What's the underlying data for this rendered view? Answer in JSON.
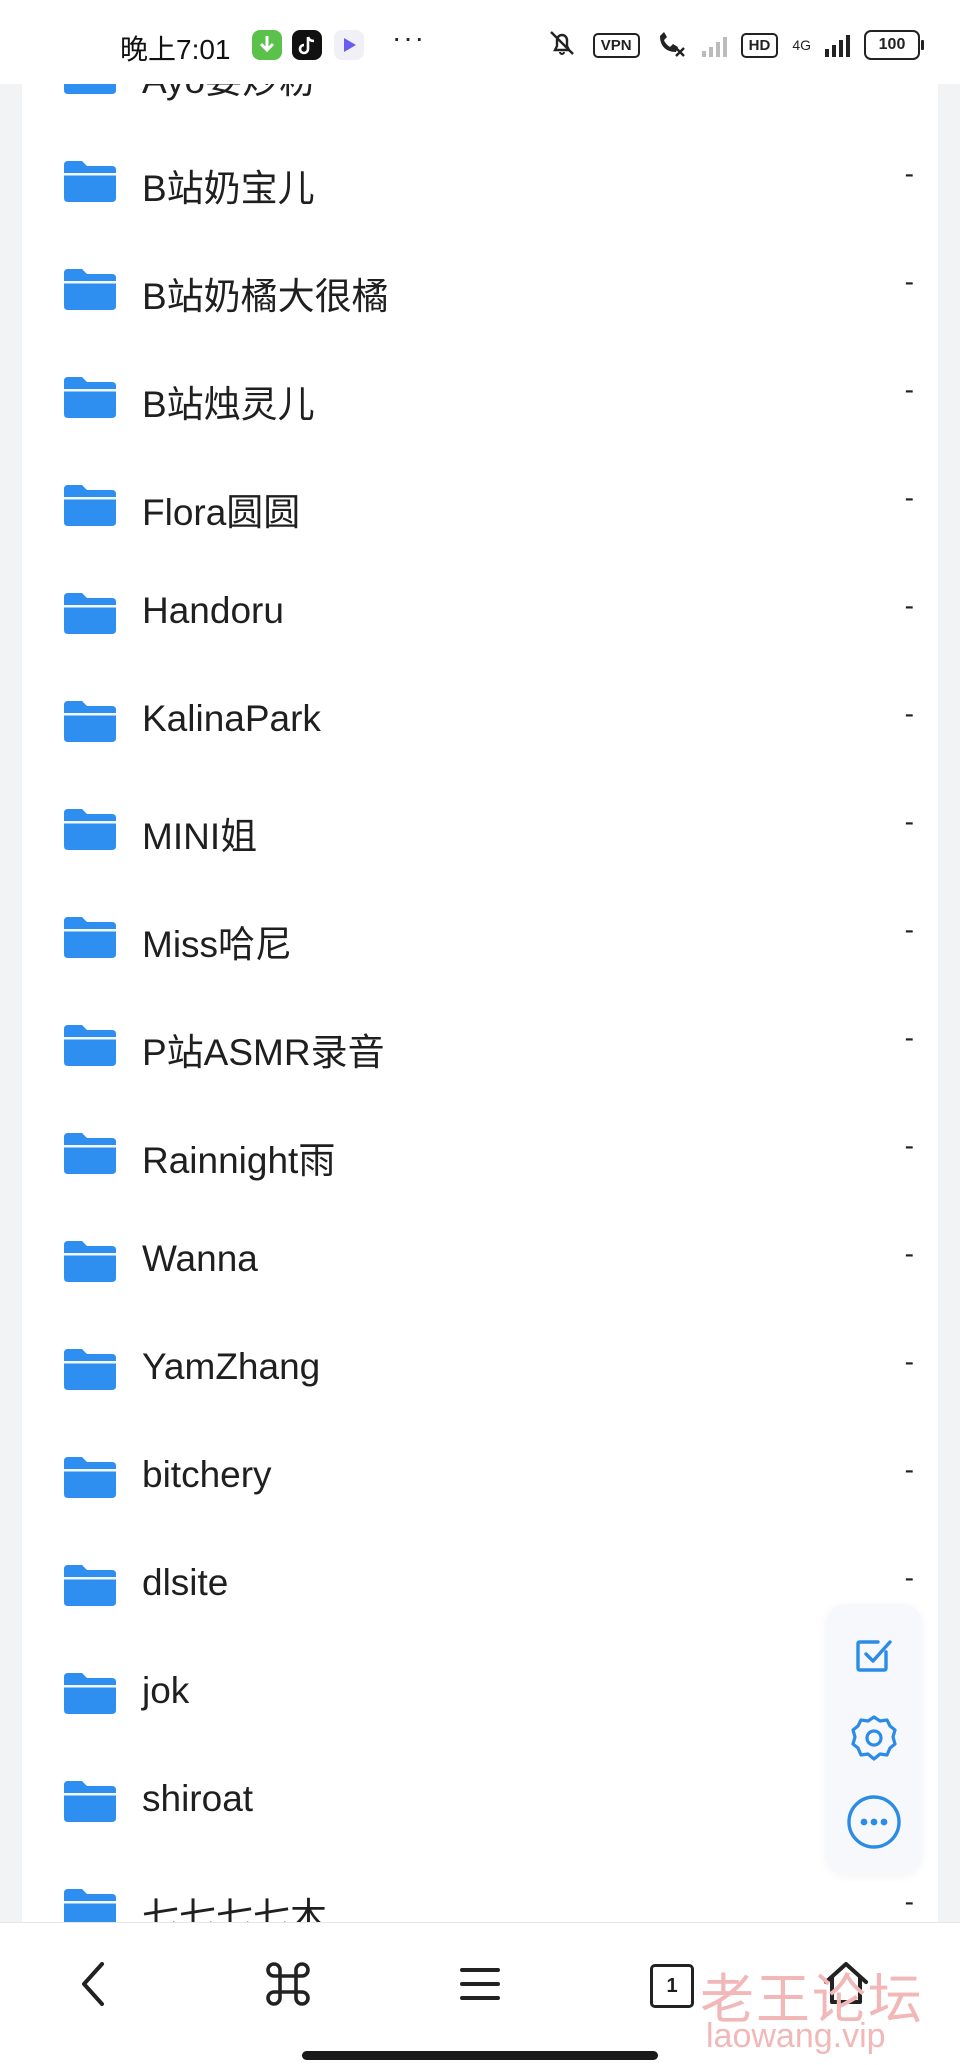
{
  "status_bar": {
    "time": "晚上7:01",
    "more": "···",
    "vpn": "VPN",
    "hd": "HD",
    "network": "4G",
    "battery": "100"
  },
  "files": [
    {
      "name": "Ayo要炒粉",
      "size": "-"
    },
    {
      "name": "B站奶宝儿",
      "size": "-"
    },
    {
      "name": "B站奶橘大很橘",
      "size": "-"
    },
    {
      "name": "B站烛灵儿",
      "size": "-"
    },
    {
      "name": "Flora圆圆",
      "size": "-"
    },
    {
      "name": "Handoru",
      "size": "-"
    },
    {
      "name": "KalinaPark",
      "size": "-"
    },
    {
      "name": "MINI姐",
      "size": "-"
    },
    {
      "name": "Miss哈尼",
      "size": "-"
    },
    {
      "name": "P站ASMR录音",
      "size": "-"
    },
    {
      "name": "Rainnight雨",
      "size": "-"
    },
    {
      "name": "Wanna",
      "size": "-"
    },
    {
      "name": "YamZhang",
      "size": "-"
    },
    {
      "name": "bitchery",
      "size": "-"
    },
    {
      "name": "dlsite",
      "size": "-"
    },
    {
      "name": "jok",
      "size": "-"
    },
    {
      "name": "shiroat",
      "size": "-"
    },
    {
      "name": "七七七七木",
      "size": "-"
    }
  ],
  "floating_actions": [
    "checkbox-icon",
    "gear-icon",
    "more-circle-icon"
  ],
  "bottom_nav": {
    "items": [
      "back-icon",
      "command-icon",
      "menu-icon",
      "tab-count",
      "home-icon"
    ],
    "tab_count": "1"
  },
  "watermark": {
    "cn": "老王论坛",
    "en": "laowang.vip"
  },
  "colors": {
    "folder": "#2f8ff0",
    "accent": "#2b8ce8"
  }
}
